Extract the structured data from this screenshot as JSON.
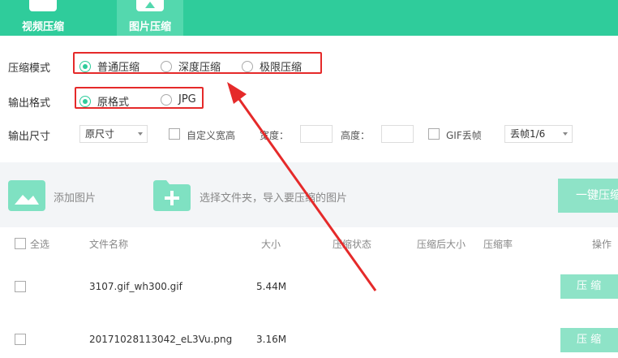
{
  "tabs": [
    {
      "label": "视频压缩"
    },
    {
      "label": "图片压缩"
    }
  ],
  "compress_mode": {
    "label": "压缩模式",
    "options": [
      {
        "label": "普通压缩",
        "checked": true
      },
      {
        "label": "深度压缩",
        "checked": false
      },
      {
        "label": "极限压缩",
        "checked": false
      }
    ]
  },
  "output_format": {
    "label": "输出格式",
    "options": [
      {
        "label": "原格式",
        "checked": true
      },
      {
        "label": "JPG",
        "checked": false
      }
    ]
  },
  "output_size": {
    "label": "输出尺寸",
    "size_select": "原尺寸",
    "custom_label": "自定义宽高",
    "width_label": "宽度：",
    "height_label": "高度：",
    "gif_label": "GIF丢帧",
    "gif_select": "丢帧1/6"
  },
  "actions": {
    "add_image": "添加图片",
    "select_folder": "选择文件夹，导入要压缩的图片",
    "one_click": "一键压缩"
  },
  "table": {
    "select_all": "全选",
    "headers": {
      "name": "文件名称",
      "size": "大小",
      "status": "压缩状态",
      "after_size": "压缩后大小",
      "ratio": "压缩率",
      "action": "操作"
    },
    "rows": [
      {
        "name": "3107.gif_wh300.gif",
        "size": "5.44M",
        "button": "压 缩"
      },
      {
        "name": "20171028113042_eL3Vu.png",
        "size": "3.16M",
        "button": "压 缩"
      }
    ]
  },
  "colors": {
    "brand": "#2fcc9b",
    "annotation": "#e52a2a"
  }
}
